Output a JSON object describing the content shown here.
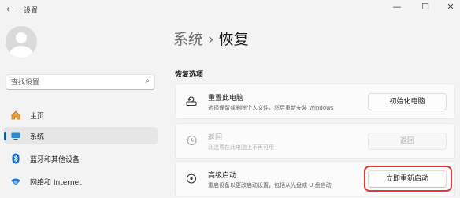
{
  "window": {
    "back_glyph": "←",
    "title": "设置",
    "minimize_glyph": "—",
    "maximize_glyph": "☐",
    "close_glyph": "✕"
  },
  "sidebar": {
    "search": {
      "placeholder": "查找设置"
    },
    "items": [
      {
        "label": "主页",
        "icon": "home-icon",
        "active": false
      },
      {
        "label": "系统",
        "icon": "display-icon",
        "active": true
      },
      {
        "label": "蓝牙和其他设备",
        "icon": "bluetooth-icon",
        "active": false
      },
      {
        "label": "网络和 Internet",
        "icon": "wifi-icon",
        "active": false
      }
    ]
  },
  "breadcrumb": {
    "parent": "系统",
    "separator": "›",
    "current": "恢复"
  },
  "section": {
    "title": "恢复选项"
  },
  "cards": [
    {
      "title": "重置此电脑",
      "description": "选择保留或删除个人文件，然后重新安装 Windows",
      "button": "初始化电脑",
      "icon": "reset-pc-icon",
      "disabled": false
    },
    {
      "title": "返回",
      "description": "此选项在此电脑上不再可用",
      "button": "返回",
      "icon": "history-icon",
      "disabled": true
    },
    {
      "title": "高级启动",
      "description": "重启设备以更改启动设置，包括从光盘或 U 盘启动",
      "button": "立即重新启动",
      "icon": "advanced-startup-icon",
      "disabled": false,
      "highlighted": true
    }
  ],
  "colors": {
    "accent": "#005fb8",
    "highlight_ring": "#e53935",
    "background": "#f3f3f3"
  }
}
